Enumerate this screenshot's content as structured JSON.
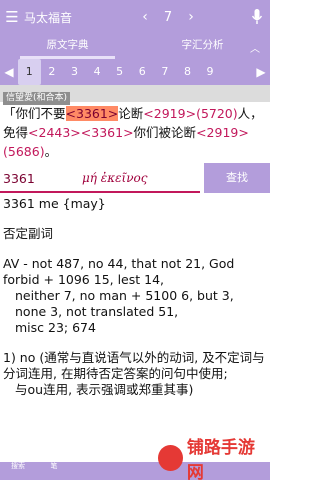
{
  "topbar": {
    "menu_icon": "hamburger-icon",
    "book": "马太福音",
    "prev": "‹",
    "chapter": "7",
    "next": "›",
    "mic_icon": "microphone-icon"
  },
  "tabs": {
    "left": "原文字典",
    "right": "字汇分析",
    "collapse": "︿"
  },
  "verse_nav": {
    "prev": "◀",
    "next": "▶",
    "numbers": [
      "1",
      "2",
      "3",
      "4",
      "5",
      "6",
      "7",
      "8",
      "9"
    ],
    "selected": "1"
  },
  "version": "信望愛(和合本)",
  "verse": {
    "p1": "「你们不要",
    "t1": "<3361>",
    "p2": "论断",
    "t2": "<2919>",
    "t3": "(5720)",
    "p3": "人，免得",
    "t4": "<2443>",
    "t5": "<3361>",
    "p4": "你们被论断",
    "t6": "<2919>",
    "t7": "(5686)",
    "p5": "。"
  },
  "search": {
    "number": "3361",
    "greek": "μή ἐκεῖνος",
    "button": "查找"
  },
  "dict": {
    "line1": "3361 me {may}",
    "line2": "否定副词",
    "line3": "AV - not 487, no 44, that not 21, God forbid + 1096 15, lest 14,",
    "line4": "neither 7, no man + 5100 6, but 3, none 3, not translated 51,",
    "line5": "misc 23; 674",
    "line6": "1) no (通常与直说语气以外的动词, 及不定词与分词连用, 在期待否定答案的问句中使用;",
    "line7": "与ou连用, 表示强调或郑重其事)"
  },
  "bottom": {
    "b1": "搜索",
    "b2": "笔"
  },
  "watermark": {
    "text": "铺路手游网"
  }
}
